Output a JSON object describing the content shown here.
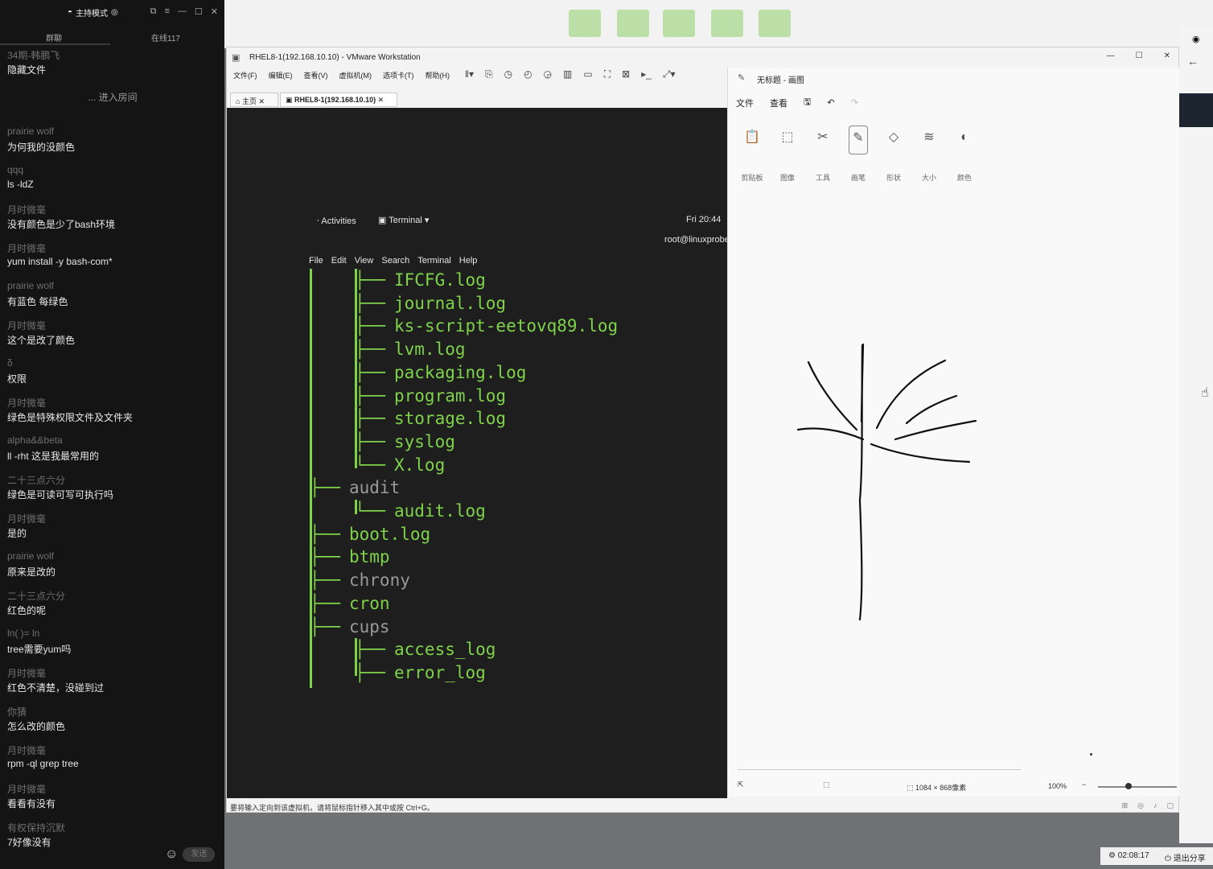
{
  "chat": {
    "mode_label": "主持模式",
    "tabs": [
      "群聊",
      "在线117"
    ],
    "messages": [
      {
        "nick": "34期-韩鹏飞",
        "text": "隐藏文件"
      },
      {
        "system": "... 进入房间"
      },
      {
        "nick": "prairie wolf",
        "text": "为何我的没颜色"
      },
      {
        "nick": "qqq",
        "text": "ls -ldZ"
      },
      {
        "nick": "月时微毫",
        "text": "没有颜色是少了bash环境"
      },
      {
        "nick": "月时微毫",
        "text": "yum install -y bash-com*"
      },
      {
        "nick": "prairie wolf",
        "text": "有蓝色 每绿色"
      },
      {
        "nick": "月时微毫",
        "text": "这个是改了颜色"
      },
      {
        "nick": "δ",
        "text": "权限"
      },
      {
        "nick": "月时微毫",
        "text": "绿色是特殊权限文件及文件夹"
      },
      {
        "nick": "alpha&&beta",
        "text": "ll -rht  这是我最常用的"
      },
      {
        "nick": "二十三点六分",
        "text": "绿色是可读可写可执行吗"
      },
      {
        "nick": "月时微毫",
        "text": "是的"
      },
      {
        "nick": "prairie wolf",
        "text": "原来是改的"
      },
      {
        "nick": "二十三点六分",
        "text": "红色的呢"
      },
      {
        "nick": "ln(     )=      ln",
        "text": "tree需要yum吗"
      },
      {
        "nick": "月时微毫",
        "text": "红色不清楚，没碰到过"
      },
      {
        "nick": "你猜",
        "text": "怎么改的颜色"
      },
      {
        "nick": "月时微毫",
        "text": "rpm -ql grep tree"
      },
      {
        "nick": "月时微毫",
        "text": "看看有没有"
      },
      {
        "nick": "有权保持沉默",
        "text": "7好像没有"
      }
    ],
    "send_label": "发送"
  },
  "vmware": {
    "title": "RHEL8-1(192.168.10.10) - VMware Workstation",
    "menu": [
      "文件(F)",
      "编辑(E)",
      "查看(V)",
      "虚拟机(M)",
      "选项卡(T)",
      "帮助(H)"
    ],
    "tabs": [
      "主页",
      "RHEL8-1(192.168.10.10)"
    ],
    "status_text": "要将输入定向到该虚拟机，请将鼠标指针移入其中或按 Ctrl+G。"
  },
  "gnome": {
    "activities": "Activities",
    "terminal_label": "Terminal ▾",
    "clock": "Fri 20:44",
    "prompt": "root@linuxprobe",
    "terminal_menu": [
      "File",
      "Edit",
      "View",
      "Search",
      "Terminal",
      "Help"
    ]
  },
  "tree": [
    {
      "depth": 2,
      "connector": "├──",
      "name": "IFCFG.log",
      "color": "green"
    },
    {
      "depth": 2,
      "connector": "├──",
      "name": "journal.log",
      "color": "green"
    },
    {
      "depth": 2,
      "connector": "├──",
      "name": "ks-script-eetovq89.log",
      "color": "green"
    },
    {
      "depth": 2,
      "connector": "├──",
      "name": "lvm.log",
      "color": "green"
    },
    {
      "depth": 2,
      "connector": "├──",
      "name": "packaging.log",
      "color": "green"
    },
    {
      "depth": 2,
      "connector": "├──",
      "name": "program.log",
      "color": "green"
    },
    {
      "depth": 2,
      "connector": "├──",
      "name": "storage.log",
      "color": "green"
    },
    {
      "depth": 2,
      "connector": "├──",
      "name": "syslog",
      "color": "green"
    },
    {
      "depth": 2,
      "connector": "└──",
      "name": "X.log",
      "color": "green"
    },
    {
      "depth": 1,
      "connector": "├──",
      "name": "audit",
      "color": "gray"
    },
    {
      "depth": 2,
      "connector": "└──",
      "name": "audit.log",
      "color": "green"
    },
    {
      "depth": 1,
      "connector": "├──",
      "name": "boot.log",
      "color": "green"
    },
    {
      "depth": 1,
      "connector": "├──",
      "name": "btmp",
      "color": "green"
    },
    {
      "depth": 1,
      "connector": "├──",
      "name": "chrony",
      "color": "gray"
    },
    {
      "depth": 1,
      "connector": "├──",
      "name": "cron",
      "color": "green"
    },
    {
      "depth": 1,
      "connector": "├──",
      "name": "cups",
      "color": "gray"
    },
    {
      "depth": 2,
      "connector": "├──",
      "name": "access_log",
      "color": "green"
    },
    {
      "depth": 2,
      "connector": "├──",
      "name": "error_log",
      "color": "green"
    }
  ],
  "paint": {
    "title": "无标题 - 画图",
    "menu": [
      "文件",
      "查看"
    ],
    "tools": [
      "剪贴板",
      "图像",
      "工具",
      "画笔",
      "形状",
      "大小",
      "颜色"
    ],
    "dimensions": "1084 × 868像素",
    "zoom": "100%"
  },
  "bottom": {
    "time": "02:08:17",
    "quit": "退出分享"
  },
  "colors": {
    "term_green": "#7fd34a",
    "term_gray": "#9a9a9a",
    "term_bg": "#1e1e1e"
  }
}
